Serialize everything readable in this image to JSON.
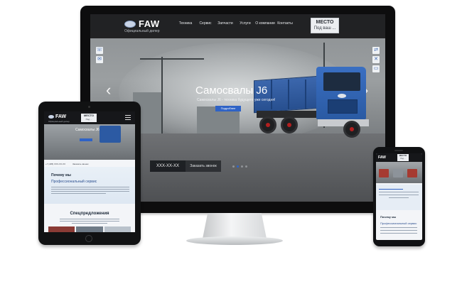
{
  "desktop": {
    "brand": {
      "name": "FAW",
      "subtitle": "Официальный дилер"
    },
    "nav": [
      "Техника",
      "Сервис",
      "Запчасти",
      "Услуги",
      "О компании",
      "Контакты"
    ],
    "place_badge": {
      "line1": "МЕСТО",
      "line2": "Под ваш ..."
    },
    "hero": {
      "title": "Самосвалы J6",
      "subtitle": "Самосвалы J6 - техника будущего уже сегодня!",
      "button": "Подробнее"
    },
    "phone_field": "XXX-XX-XX",
    "order_call": "Заказать звонок",
    "slider_dots": 4,
    "slider_active": 1,
    "arrows": {
      "left": "‹",
      "right": "›"
    },
    "side_icons_left": [
      "phone-icon",
      "mail-icon"
    ],
    "side_icons_right": [
      "share-icon",
      "wrench-icon",
      "truck-icon"
    ]
  },
  "tablet": {
    "brand": {
      "name": "FAW",
      "subtitle": "Официальный дилер"
    },
    "place_badge": {
      "line1": "МЕСТО",
      "line2": "Под ..."
    },
    "hero_title": "Самосвалы J6",
    "phone": "+7 (495) XXX-XX-XX",
    "order_call": "Заказать звонок",
    "why_us": "Почему мы",
    "professional_service": "Профессиональный сервис",
    "special_offers": "Спецпредложения"
  },
  "phone": {
    "brand": {
      "name": "FAW"
    },
    "place_badge": {
      "line1": "МЕСТО",
      "line2": "Под ..."
    },
    "why_us": "Почему мы",
    "professional_service": "Профессиональный сервис"
  },
  "colors": {
    "accent_blue": "#2f63c6",
    "header_dark": "#16171a",
    "truck_blue": "#2a5aa3",
    "frame": "#0d0d0e"
  }
}
